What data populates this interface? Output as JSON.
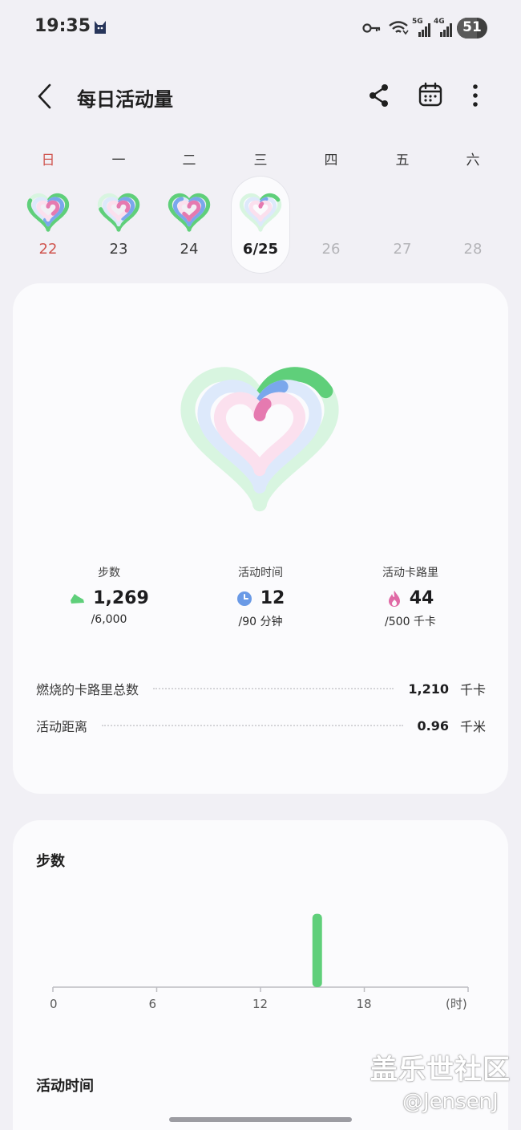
{
  "status_bar": {
    "time": "19:35",
    "network_5g": "5G",
    "network_4g": "4G",
    "battery": "51",
    "icons": [
      "cat-icon",
      "key-icon",
      "wifi-icon",
      "signal-icon",
      "signal-icon",
      "battery-icon"
    ]
  },
  "header": {
    "title": "每日活动量",
    "icons": [
      "back-arrow-icon",
      "share-icon",
      "calendar-icon",
      "more-vertical-icon"
    ]
  },
  "week": {
    "weekdays": [
      "日",
      "一",
      "二",
      "三",
      "四",
      "五",
      "六"
    ],
    "days": [
      {
        "label": "22",
        "state": "past-sunday",
        "ring": {
          "green": 0.78,
          "blue": 0.6,
          "pink": 0.35
        }
      },
      {
        "label": "23",
        "state": "past",
        "ring": {
          "green": 0.72,
          "blue": 0.38,
          "pink": 0.3
        }
      },
      {
        "label": "24",
        "state": "past",
        "ring": {
          "green": 1.0,
          "blue": 0.85,
          "pink": 0.65
        }
      },
      {
        "label": "6/25",
        "state": "selected",
        "ring": {
          "green": 0.21,
          "blue": 0.13,
          "pink": 0.09
        }
      },
      {
        "label": "26",
        "state": "future"
      },
      {
        "label": "27",
        "state": "future"
      },
      {
        "label": "28",
        "state": "future"
      }
    ]
  },
  "summary": {
    "stats": [
      {
        "label": "步数",
        "value": "1,269",
        "goal": "/6,000",
        "icon": "shoe-icon",
        "progress": 0.21
      },
      {
        "label": "活动时间",
        "value": "12",
        "goal": "/90 分钟",
        "icon": "clock-icon",
        "progress": 0.13
      },
      {
        "label": "活动卡路里",
        "value": "44",
        "goal": "/500 千卡",
        "icon": "flame-icon",
        "progress": 0.09
      }
    ],
    "details": [
      {
        "label": "燃烧的卡路里总数",
        "value": "1,210",
        "unit": "千卡"
      },
      {
        "label": "活动距离",
        "value": "0.96",
        "unit": "千米"
      }
    ]
  },
  "colors": {
    "steps": "#5fcf7a",
    "active_time": "#7aa7ec",
    "calories": "#e57ab0",
    "sunday": "#d0554f"
  },
  "steps_section": {
    "title": "步数",
    "next_title": "活动时间"
  },
  "chart_data": {
    "type": "bar",
    "title": "步数",
    "xlabel": "(时)",
    "x_ticks": [
      "0",
      "6",
      "12",
      "18"
    ],
    "xlim": [
      0,
      24
    ],
    "x": [
      15
    ],
    "values": [
      1269
    ],
    "ylim": [
      0,
      1500
    ],
    "color": "#5fcf7a",
    "grid": false
  },
  "watermark": {
    "line1": "盖乐世社区",
    "line2": "@JensenJ"
  }
}
